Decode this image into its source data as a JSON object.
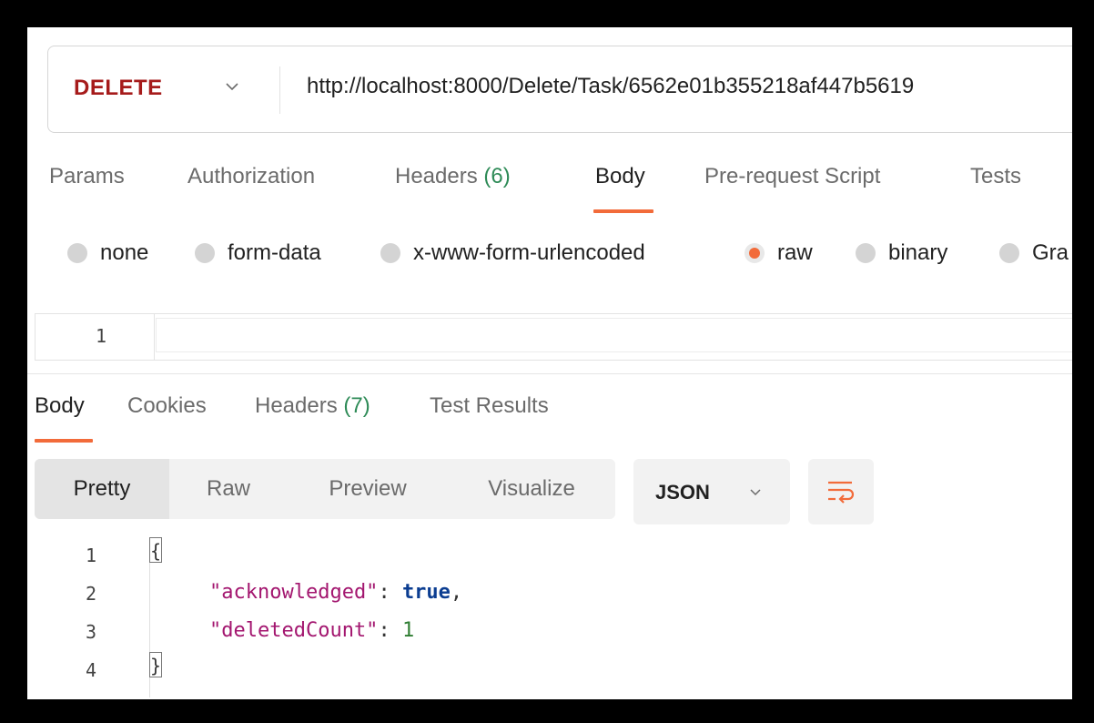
{
  "request": {
    "method": "DELETE",
    "url": "http://localhost:8000/Delete/Task/6562e01b355218af447b5619"
  },
  "request_tabs": [
    {
      "label": "Params",
      "count": null
    },
    {
      "label": "Authorization",
      "count": null
    },
    {
      "label": "Headers",
      "count": "(6)"
    },
    {
      "label": "Body",
      "count": null,
      "active": true
    },
    {
      "label": "Pre-request Script",
      "count": null
    },
    {
      "label": "Tests",
      "count": null
    }
  ],
  "body_types": [
    {
      "label": "none",
      "checked": false
    },
    {
      "label": "form-data",
      "checked": false
    },
    {
      "label": "x-www-form-urlencoded",
      "checked": false
    },
    {
      "label": "raw",
      "checked": true
    },
    {
      "label": "binary",
      "checked": false
    },
    {
      "label": "Gra",
      "checked": false
    }
  ],
  "request_editor": {
    "line_number": "1"
  },
  "response_tabs": [
    {
      "label": "Body",
      "count": null,
      "active": true
    },
    {
      "label": "Cookies",
      "count": null
    },
    {
      "label": "Headers",
      "count": "(7)"
    },
    {
      "label": "Test Results",
      "count": null
    }
  ],
  "view_modes": [
    {
      "label": "Pretty",
      "active": true
    },
    {
      "label": "Raw"
    },
    {
      "label": "Preview"
    },
    {
      "label": "Visualize"
    }
  ],
  "format": {
    "label": "JSON"
  },
  "response_body": {
    "line_numbers": [
      "1",
      "2",
      "3",
      "4"
    ],
    "open_brace": "{",
    "close_brace": "}",
    "key1": "\"acknowledged\"",
    "val1": "true",
    "key2": "\"deletedCount\"",
    "val2": "1",
    "colon": ": ",
    "comma": ","
  },
  "colors": {
    "accent": "#f26b3a",
    "method_delete": "#a61b1b",
    "count_green": "#2e8b57"
  },
  "icons": {
    "method_dropdown": "chevron-down-icon",
    "format_dropdown": "chevron-down-icon",
    "wrap": "wrap-lines-icon"
  }
}
